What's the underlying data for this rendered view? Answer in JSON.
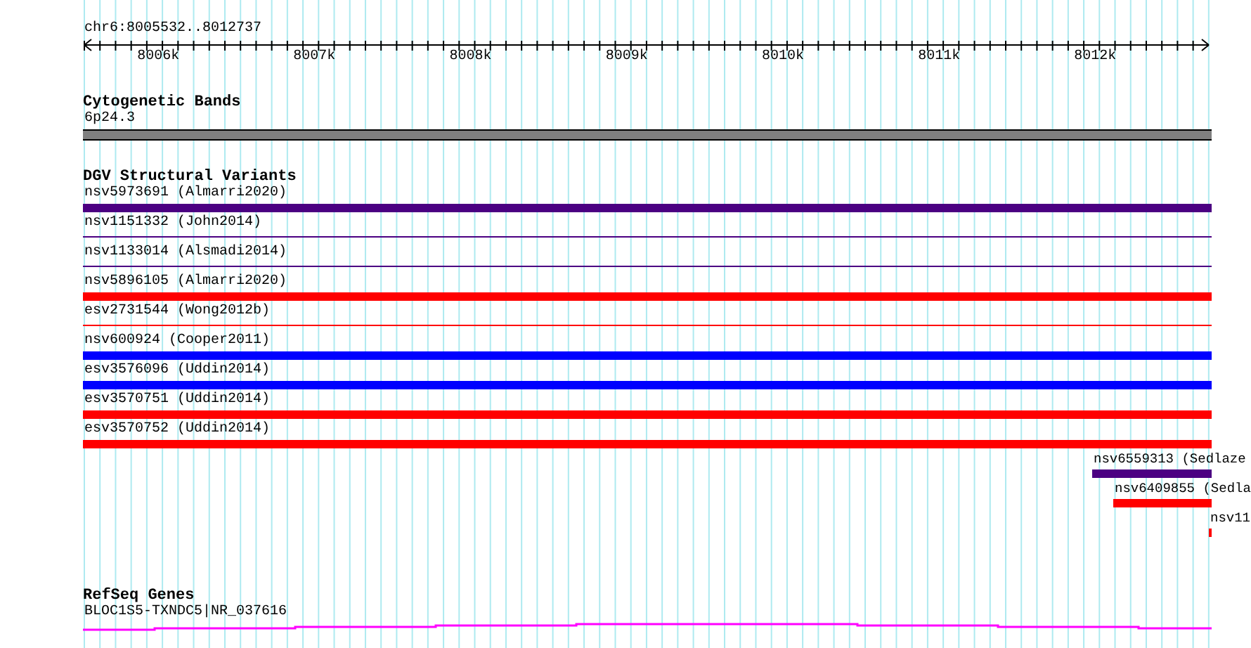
{
  "location": "chr6:8005532..8012737",
  "ruler": {
    "ticks": [
      "8006k",
      "8007k",
      "8008k",
      "8009k",
      "8010k",
      "8011k",
      "8012k"
    ]
  },
  "tracks": [
    {
      "kind": "bands",
      "title": "Cytogenetic Bands",
      "features": [
        {
          "label": "6p24.3",
          "kind": "band",
          "color": "#808080"
        }
      ]
    },
    {
      "kind": "variants",
      "title": "DGV Structural Variants",
      "features": [
        {
          "label": "nsv5973691 (Almarri2020)",
          "kind": "thick",
          "color": "#4b0082"
        },
        {
          "label": "nsv1151332 (John2014)",
          "kind": "thin",
          "color": "#4b0082"
        },
        {
          "label": "nsv1133014 (Alsmadi2014)",
          "kind": "thin",
          "color": "#4b0082"
        },
        {
          "label": "nsv5896105 (Almarri2020)",
          "kind": "thick",
          "color": "#ff0000"
        },
        {
          "label": "esv2731544 (Wong2012b)",
          "kind": "thin",
          "color": "#ff0000"
        },
        {
          "label": "nsv600924 (Cooper2011)",
          "kind": "thick",
          "color": "#0000ff"
        },
        {
          "label": "esv3576096 (Uddin2014)",
          "kind": "thick",
          "color": "#0000ff"
        },
        {
          "label": "esv3570751 (Uddin2014)",
          "kind": "thick",
          "color": "#ff0000"
        },
        {
          "label": "esv3570752 (Uddin2014)",
          "kind": "thick",
          "color": "#ff0000"
        },
        {
          "label": "nsv6559313 (Sedlaze",
          "kind": "thick",
          "color": "#4b0082"
        },
        {
          "label": "nsv6409855 (Sedla",
          "kind": "thick",
          "color": "#ff0000"
        },
        {
          "label": "nsv11",
          "kind": "thick",
          "color": "#ff0000"
        }
      ]
    },
    {
      "kind": "genes",
      "title": "RefSeq Genes",
      "features": [
        {
          "label": "BLOC1S5-TXNDC5|NR_037616",
          "kind": "gene",
          "color": "#ff00ff"
        }
      ]
    }
  ]
}
